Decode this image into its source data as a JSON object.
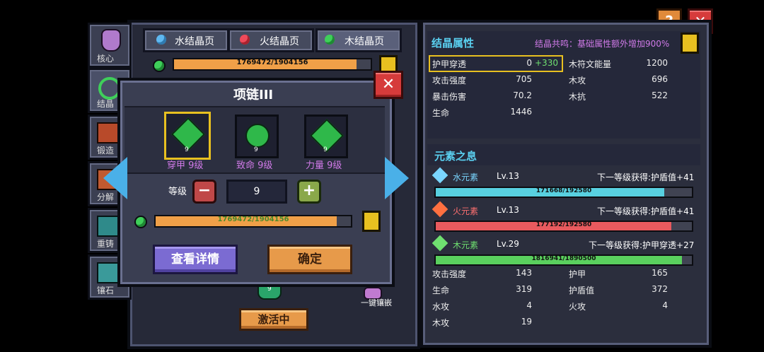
{
  "tabs": [
    {
      "label": "水结晶页",
      "gem_color": "#5fb8f0"
    },
    {
      "label": "火结晶页",
      "gem_color": "#f04a5a"
    },
    {
      "label": "木结晶页",
      "gem_color": "#3fcf5a"
    }
  ],
  "side_tabs": [
    {
      "label": "核心"
    },
    {
      "label": "结晶"
    },
    {
      "label": "锻造"
    },
    {
      "label": "分解"
    },
    {
      "label": "重铸"
    },
    {
      "label": "镶石"
    }
  ],
  "main_progress": {
    "text": "1769472/1904156",
    "fraction": 0.929
  },
  "modal": {
    "title": "项链III",
    "gems": [
      {
        "label": "穿甲 9级",
        "level_tag": "9",
        "selected": true
      },
      {
        "label": "致命 9级",
        "level_tag": "9",
        "selected": false
      },
      {
        "label": "力量 9级",
        "level_tag": "9",
        "selected": false
      }
    ],
    "level_label": "等级",
    "level_value": "9",
    "progress_text": "1769472/1904156",
    "progress_fraction": 0.929,
    "details_button": "查看详情",
    "confirm_button": "确定"
  },
  "bottom": {
    "activate_button": "激活中",
    "one_click_label": "一键镶嵌",
    "gem_level_tag": "9"
  },
  "right": {
    "crystal_title": "结晶属性",
    "resonance": "结晶共鸣：基础属性额外增加900%",
    "stats_left": [
      {
        "name": "护甲穿透",
        "value": "0",
        "bonus": "+330"
      },
      {
        "name": "攻击强度",
        "value": "705"
      },
      {
        "name": "暴击伤害",
        "value": "70.2"
      },
      {
        "name": "生命",
        "value": "1446"
      }
    ],
    "stats_right": [
      {
        "name": "木符文能量",
        "value": "1200"
      },
      {
        "name": "木攻",
        "value": "696"
      },
      {
        "name": "木抗",
        "value": "522"
      }
    ],
    "element_title": "元素之息",
    "elements": [
      {
        "name": "水元素",
        "level": "Lv.13",
        "next": "下一等级获得:护盾值+41",
        "progress": "171668/192580",
        "fraction": 0.891,
        "color": "#58d0e0",
        "name_color": "#7ad6ff"
      },
      {
        "name": "火元素",
        "level": "Lv.13",
        "next": "下一等级获得:护盾值+41",
        "progress": "177192/192580",
        "fraction": 0.92,
        "color": "#e85a5e",
        "name_color": "#ff7070"
      },
      {
        "name": "木元素",
        "level": "Lv.29",
        "next": "下一等级获得:护甲穿透+27",
        "progress": "1816941/1890500",
        "fraction": 0.961,
        "color": "#5ad05e",
        "name_color": "#6fe070"
      }
    ],
    "bottom_stats": [
      {
        "name": "攻击强度",
        "value": "143"
      },
      {
        "name": "护甲",
        "value": "165"
      },
      {
        "name": "生命",
        "value": "319"
      },
      {
        "name": "护盾值",
        "value": "372"
      },
      {
        "name": "水攻",
        "value": "4"
      },
      {
        "name": "火攻",
        "value": "4"
      },
      {
        "name": "木攻",
        "value": "19"
      }
    ]
  },
  "icons": {
    "help": "?",
    "close": "✕"
  }
}
